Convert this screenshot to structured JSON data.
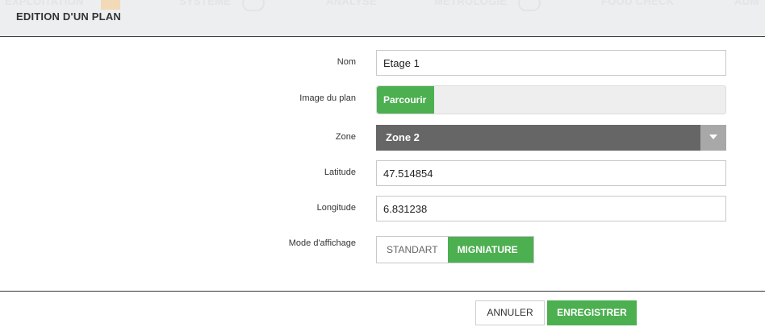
{
  "background_nav": {
    "items": [
      "EXPLOITATION",
      "SYSTEME",
      "ANALYSE",
      "METROLOGIE",
      "FOOD CHECK",
      "ADM"
    ]
  },
  "modal": {
    "title": "EDITION D'UN PLAN"
  },
  "form": {
    "nom": {
      "label": "Nom",
      "value": "Etage 1"
    },
    "image": {
      "label": "Image du plan",
      "browse_label": "Parcourir"
    },
    "zone": {
      "label": "Zone",
      "value": "Zone 2"
    },
    "latitude": {
      "label": "Latitude",
      "value": "47.514854"
    },
    "longitude": {
      "label": "Longitude",
      "value": "6.831238"
    },
    "mode": {
      "label": "Mode d'affichage",
      "options": [
        "STANDART",
        "MIGNIATURE"
      ],
      "selected": "MIGNIATURE"
    }
  },
  "footer": {
    "cancel_label": "ANNULER",
    "save_label": "ENREGISTRER"
  },
  "colors": {
    "accent": "#4caf50",
    "select_bg": "#666666",
    "header_bg": "#eceeef"
  }
}
